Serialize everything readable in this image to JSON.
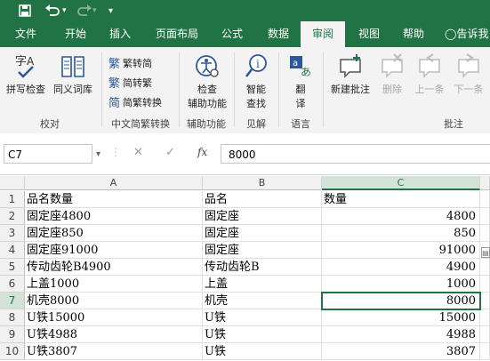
{
  "qat": {
    "save_icon": "save-icon",
    "undo_icon": "undo-icon",
    "redo_icon": "redo-icon",
    "customize": "▾"
  },
  "tabs": [
    "文件",
    "开始",
    "插入",
    "页面布局",
    "公式",
    "数据",
    "审阅",
    "视图",
    "帮助"
  ],
  "tell_me": "告诉我",
  "ribbon": {
    "proofing": {
      "spell": "拼写检查",
      "thesaurus": "同义词库",
      "label": "校对"
    },
    "chinese": {
      "to_trad": "繁转简",
      "to_simp": "简转繁",
      "convert": "简繁转换",
      "label": "中文简繁转换"
    },
    "accessibility": {
      "check_line1": "检查",
      "check_line2": "辅助功能",
      "label": "辅助功能"
    },
    "insights": {
      "smart_line1": "智能",
      "smart_line2": "查找",
      "label": "见解"
    },
    "language": {
      "translate_line1": "翻",
      "translate_line2": "译",
      "label": "语言"
    },
    "comments": {
      "new": "新建批注",
      "delete": "删除",
      "prev": "上一条",
      "next": "下一条",
      "label": "批注"
    }
  },
  "formula_bar": {
    "name_box": "C7",
    "cancel": "✕",
    "enter": "✓",
    "fx": "fx",
    "value": "8000"
  },
  "columns": [
    "A",
    "B",
    "C"
  ],
  "rows": [
    {
      "n": "1",
      "a": "品名数量",
      "b": "品名",
      "c": "数量"
    },
    {
      "n": "2",
      "a": "固定座4800",
      "b": "固定座",
      "c": "4800"
    },
    {
      "n": "3",
      "a": "固定座850",
      "b": "固定座",
      "c": "850"
    },
    {
      "n": "4",
      "a": "固定座91000",
      "b": "固定座",
      "c": "91000"
    },
    {
      "n": "5",
      "a": "传动齿轮B4900",
      "b": "传动齿轮B",
      "c": "4900"
    },
    {
      "n": "6",
      "a": "上盖1000",
      "b": "上盖",
      "c": "1000"
    },
    {
      "n": "7",
      "a": "机壳8000",
      "b": "机壳",
      "c": "8000"
    },
    {
      "n": "8",
      "a": "U铁15000",
      "b": "U铁",
      "c": "15000"
    },
    {
      "n": "9",
      "a": "U铁4988",
      "b": "U铁",
      "c": "4988"
    },
    {
      "n": "10",
      "a": "U铁3807",
      "b": "U铁",
      "c": "3807"
    }
  ],
  "selected_cell": "C7",
  "colors": {
    "accent": "#217346"
  }
}
